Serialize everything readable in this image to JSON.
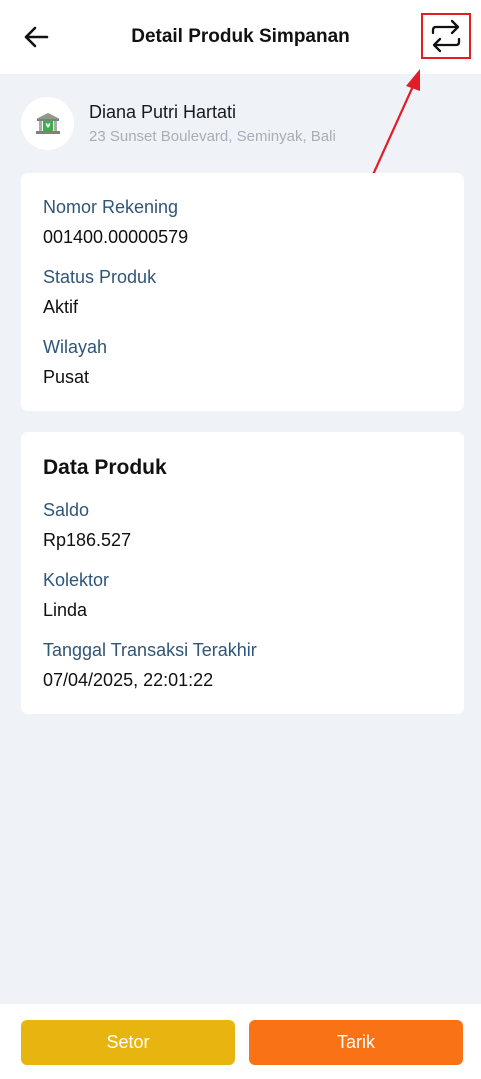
{
  "header": {
    "title": "Detail Produk Simpanan",
    "back_icon": "arrow-left-icon",
    "swap_icon": "swap-arrows-icon"
  },
  "profile": {
    "name": "Diana Putri Hartati",
    "address": "23 Sunset Boulevard, Seminyak, Bali",
    "avatar_icon": "bank-building-icon"
  },
  "account_card": {
    "fields": [
      {
        "label": "Nomor Rekening",
        "value": "001400.00000579"
      },
      {
        "label": "Status Produk",
        "value": "Aktif"
      },
      {
        "label": "Wilayah",
        "value": "Pusat"
      }
    ]
  },
  "product_card": {
    "title": "Data Produk",
    "fields": [
      {
        "label": "Saldo",
        "value": "Rp186.527"
      },
      {
        "label": "Kolektor",
        "value": "Linda"
      },
      {
        "label": "Tanggal Transaksi Terakhir",
        "value": "07/04/2025, 22:01:22"
      }
    ]
  },
  "actions": {
    "setor_label": "Setor",
    "tarik_label": "Tarik"
  },
  "colors": {
    "background": "#eff3f8",
    "label": "#2f5578",
    "setor": "#e8b40f",
    "tarik": "#f97316",
    "highlight": "#e31d25",
    "avatar_icon_green": "#3cae4d"
  }
}
